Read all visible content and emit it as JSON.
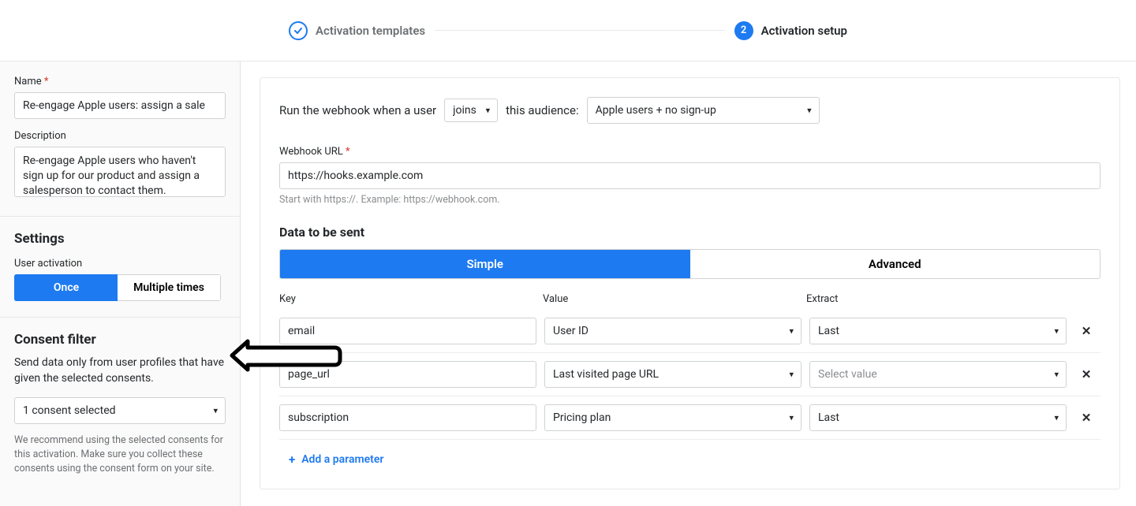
{
  "stepper": {
    "step1": {
      "label": "Activation templates"
    },
    "step2": {
      "number": "2",
      "label": "Activation setup"
    }
  },
  "sidebar": {
    "name_label": "Name",
    "name_value": "Re-engage Apple users: assign a sale",
    "description_label": "Description",
    "description_value": "Re-engage Apple users who haven't sign up for our product and assign a salesperson to contact them.",
    "settings_title": "Settings",
    "user_activation_label": "User activation",
    "seg_once": "Once",
    "seg_multiple": "Multiple times",
    "consent_title": "Consent filter",
    "consent_desc": "Send data only from user profiles that have given the selected consents.",
    "consent_select": "1 consent selected",
    "consent_note": "We recommend using the selected consents for this activation. Make sure you collect these consents using the consent form on your site."
  },
  "main": {
    "trigger_prefix": "Run the webhook when a user",
    "trigger_action": "joins",
    "trigger_mid": "this audience:",
    "audience": "Apple users + no sign-up",
    "webhook_label": "Webhook URL",
    "webhook_value": "https://hooks.example.com",
    "webhook_help": "Start with https://. Example: https://webhook.com.",
    "data_title": "Data to be sent",
    "tab_simple": "Simple",
    "tab_advanced": "Advanced",
    "col_key": "Key",
    "col_value": "Value",
    "col_extract": "Extract",
    "rows": [
      {
        "key": "email",
        "value": "User ID",
        "extract": "Last",
        "extract_placeholder": false
      },
      {
        "key": "page_url",
        "value": "Last visited page URL",
        "extract": "Select value",
        "extract_placeholder": true
      },
      {
        "key": "subscription",
        "value": "Pricing plan",
        "extract": "Last",
        "extract_placeholder": false
      }
    ],
    "add_param": "Add a parameter"
  }
}
